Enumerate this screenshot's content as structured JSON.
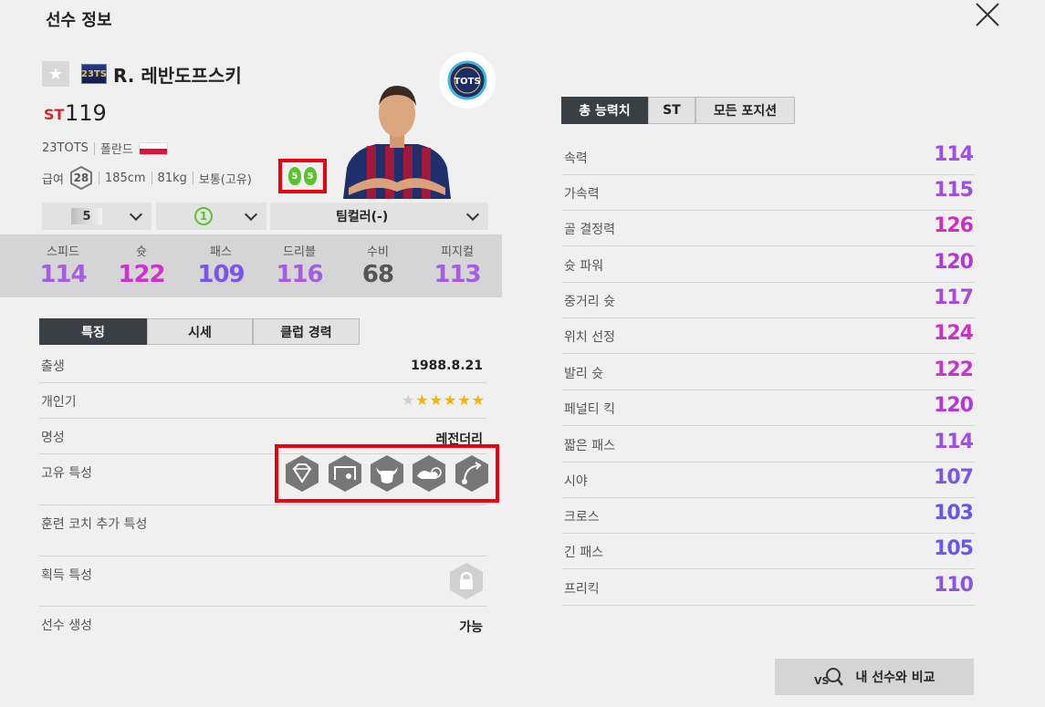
{
  "header": {
    "title": "선수 정보"
  },
  "player": {
    "season_badge": "23TS",
    "name": "R. 레반도프스키",
    "position": "ST",
    "overall": "119",
    "season_name": "23TOTS",
    "nation": "폴란드",
    "salary_label": "급여",
    "salary": "28",
    "height": "185cm",
    "weight": "81kg",
    "body_type": "보통(고유)",
    "left_foot": "5",
    "right_foot": "5",
    "team_badge": "TOTS"
  },
  "selectors": {
    "level": "5",
    "chemistry": "1",
    "team_color": "팀컬러(-)"
  },
  "summary_stats": [
    {
      "label": "스피드",
      "value": "114",
      "color": "#a55ee0"
    },
    {
      "label": "슛",
      "value": "122",
      "color": "#cc33cc"
    },
    {
      "label": "패스",
      "value": "109",
      "color": "#7a55e8"
    },
    {
      "label": "드리블",
      "value": "116",
      "color": "#a55ee0"
    },
    {
      "label": "수비",
      "value": "68",
      "color": "#555555"
    },
    {
      "label": "피지컬",
      "value": "113",
      "color": "#a55ee0"
    }
  ],
  "left_tabs": [
    "특징",
    "시세",
    "클럽 경력"
  ],
  "info": {
    "birth_label": "출생",
    "birth": "1988.8.21",
    "popularity_label": "개인기",
    "skill_stars": 5,
    "skill_stars_max": 6,
    "reputation_label": "명성",
    "reputation": "레전더리",
    "traits_label": "고유 특성",
    "trait_icons": [
      "diamond-trait-icon",
      "goal-trait-icon",
      "bull-trait-icon",
      "speed-trait-icon",
      "curve-shot-trait-icon"
    ],
    "coach_label": "훈련 코치 추가 특성",
    "acquired_label": "획득 특성",
    "create_label": "선수 생성",
    "create": "가능"
  },
  "right_tabs": [
    "총 능력치",
    "ST",
    "모든 포지션"
  ],
  "attributes": [
    {
      "label": "속력",
      "value": "114",
      "color": "#a04ee0"
    },
    {
      "label": "가속력",
      "value": "115",
      "color": "#a04ee0"
    },
    {
      "label": "골 결정력",
      "value": "126",
      "color": "#cc2fbd"
    },
    {
      "label": "슛 파워",
      "value": "120",
      "color": "#b13ad6"
    },
    {
      "label": "중거리 슛",
      "value": "117",
      "color": "#a84ad8"
    },
    {
      "label": "위치 선정",
      "value": "124",
      "color": "#c634c4"
    },
    {
      "label": "발리 슛",
      "value": "122",
      "color": "#c238c8"
    },
    {
      "label": "페널티 킥",
      "value": "120",
      "color": "#b13ad6"
    },
    {
      "label": "짧은 패스",
      "value": "114",
      "color": "#a04ee0"
    },
    {
      "label": "시야",
      "value": "107",
      "color": "#7a55e8"
    },
    {
      "label": "크로스",
      "value": "103",
      "color": "#6a55e8"
    },
    {
      "label": "긴 패스",
      "value": "105",
      "color": "#6f55e8"
    },
    {
      "label": "프리킥",
      "value": "110",
      "color": "#8a55e6"
    }
  ],
  "compare_button": "내 선수와 비교"
}
